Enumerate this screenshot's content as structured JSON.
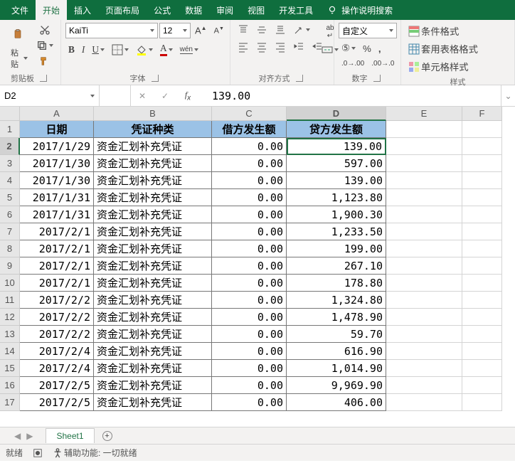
{
  "menu": {
    "tabs": [
      "文件",
      "开始",
      "插入",
      "页面布局",
      "公式",
      "数据",
      "审阅",
      "视图",
      "开发工具"
    ],
    "active": 1,
    "tell": "操作说明搜索"
  },
  "ribbon": {
    "clipboard": {
      "label": "剪贴板",
      "paste": "粘贴"
    },
    "font": {
      "label": "字体",
      "name": "KaiTi",
      "size": "12"
    },
    "align": {
      "label": "对齐方式"
    },
    "number": {
      "label": "数字",
      "format": "自定义"
    },
    "styles": {
      "label": "样式",
      "cf": "条件格式",
      "ft": "套用表格格式",
      "cs": "单元格样式"
    }
  },
  "fbar": {
    "name": "D2",
    "formula": "139.00"
  },
  "columns": [
    "A",
    "B",
    "C",
    "D",
    "E",
    "F"
  ],
  "headers": [
    "日期",
    "凭证种类",
    "借方发生额",
    "贷方发生额"
  ],
  "active_cell": {
    "row": 2,
    "col": 4
  },
  "chart_data": {
    "type": "table",
    "columns": [
      "日期",
      "凭证种类",
      "借方发生额",
      "贷方发生额"
    ],
    "rows": [
      [
        "2017/1/29",
        "资金汇划补充凭证",
        "0.00",
        "139.00"
      ],
      [
        "2017/1/30",
        "资金汇划补充凭证",
        "0.00",
        "597.00"
      ],
      [
        "2017/1/30",
        "资金汇划补充凭证",
        "0.00",
        "139.00"
      ],
      [
        "2017/1/31",
        "资金汇划补充凭证",
        "0.00",
        "1,123.80"
      ],
      [
        "2017/1/31",
        "资金汇划补充凭证",
        "0.00",
        "1,900.30"
      ],
      [
        "2017/2/1",
        "资金汇划补充凭证",
        "0.00",
        "1,233.50"
      ],
      [
        "2017/2/1",
        "资金汇划补充凭证",
        "0.00",
        "199.00"
      ],
      [
        "2017/2/1",
        "资金汇划补充凭证",
        "0.00",
        "267.10"
      ],
      [
        "2017/2/1",
        "资金汇划补充凭证",
        "0.00",
        "178.80"
      ],
      [
        "2017/2/2",
        "资金汇划补充凭证",
        "0.00",
        "1,324.80"
      ],
      [
        "2017/2/2",
        "资金汇划补充凭证",
        "0.00",
        "1,478.90"
      ],
      [
        "2017/2/2",
        "资金汇划补充凭证",
        "0.00",
        "59.70"
      ],
      [
        "2017/2/4",
        "资金汇划补充凭证",
        "0.00",
        "616.90"
      ],
      [
        "2017/2/4",
        "资金汇划补充凭证",
        "0.00",
        "1,014.90"
      ],
      [
        "2017/2/5",
        "资金汇划补充凭证",
        "0.00",
        "9,969.90"
      ],
      [
        "2017/2/5",
        "资金汇划补充凭证",
        "0.00",
        "406.00"
      ]
    ]
  },
  "tabs": {
    "sheet": "Sheet1"
  },
  "status": {
    "ready": "就绪",
    "acc": "辅助功能: 一切就绪"
  }
}
